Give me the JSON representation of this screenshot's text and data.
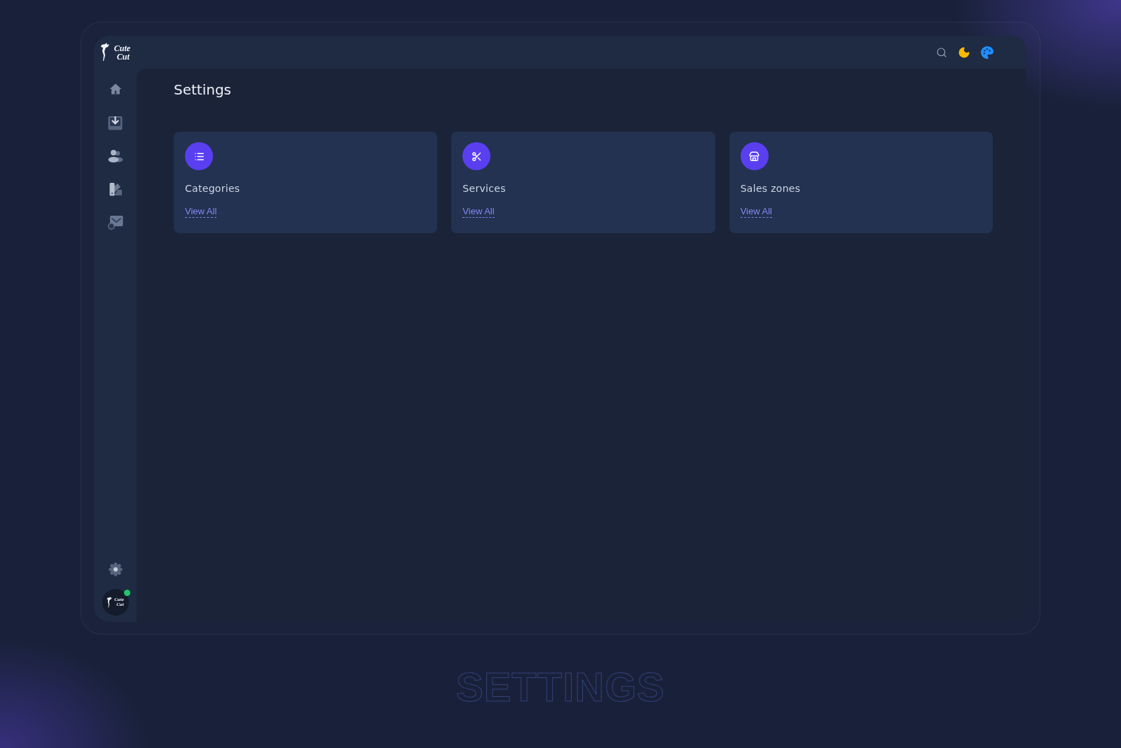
{
  "sidebar": {
    "logo": {
      "lines": [
        "Cute",
        "Cut"
      ]
    },
    "user": {
      "logo": {
        "lines": [
          "Cute",
          "Cut"
        ]
      },
      "online": true
    }
  },
  "page": {
    "title": "Settings",
    "cards": [
      {
        "title": "Categories",
        "link": "View All"
      },
      {
        "title": "Services",
        "link": "View All"
      },
      {
        "title": "Sales zones",
        "link": "View All"
      }
    ]
  },
  "caption": "SETTINGS"
}
